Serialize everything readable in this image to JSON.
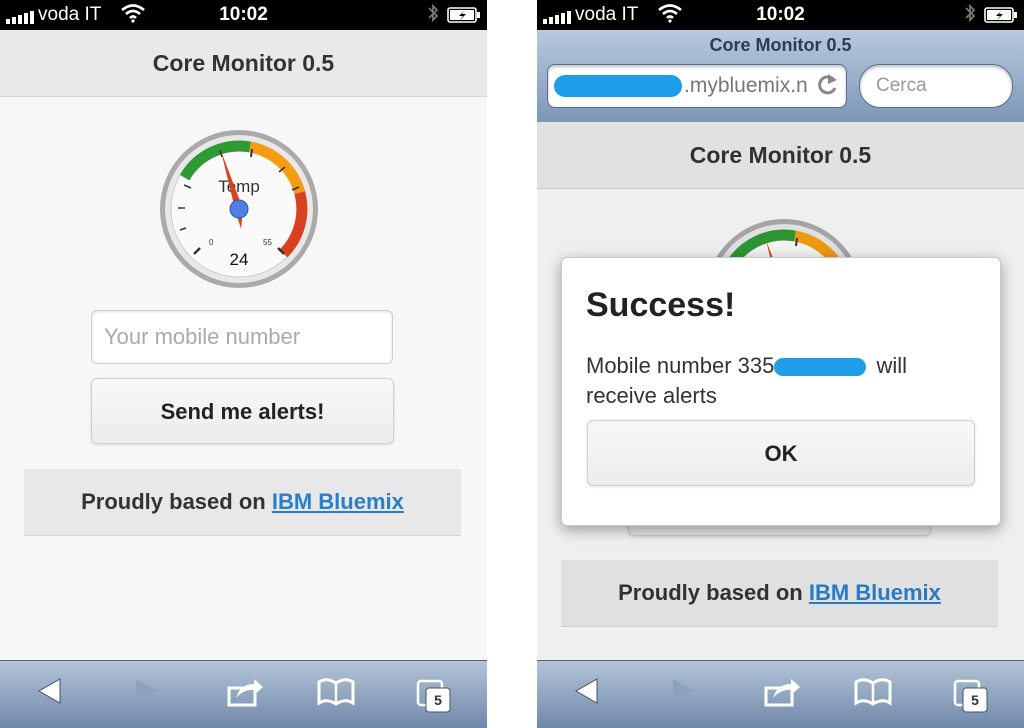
{
  "status_bar": {
    "carrier": "voda IT",
    "time": "10:02"
  },
  "left": {
    "header_title": "Core Monitor 0.5",
    "gauge": {
      "label": "Temp",
      "value": "24",
      "min": "0",
      "max": "55"
    },
    "mobile_placeholder": "Your mobile number",
    "send_button": "Send me alerts!",
    "footer_prefix": "Proudly based on",
    "footer_link": "IBM Bluemix"
  },
  "right": {
    "browser_title": "Core Monitor 0.5",
    "url_text": ".mybluemix.n",
    "search_placeholder": "Cerca",
    "header_title": "Core Monitor 0.5",
    "dialog": {
      "title": "Success!",
      "message_prefix": "Mobile number 335",
      "message_suffix": "will receive alerts",
      "ok_label": "OK"
    },
    "footer_prefix": "Proudly based on",
    "footer_link": "IBM Bluemix"
  },
  "toolbar": {
    "tabs_count": "5"
  },
  "colors": {
    "link": "#2a7fc9",
    "needle": "#d9401f",
    "redaction": "#1e9ee8"
  }
}
